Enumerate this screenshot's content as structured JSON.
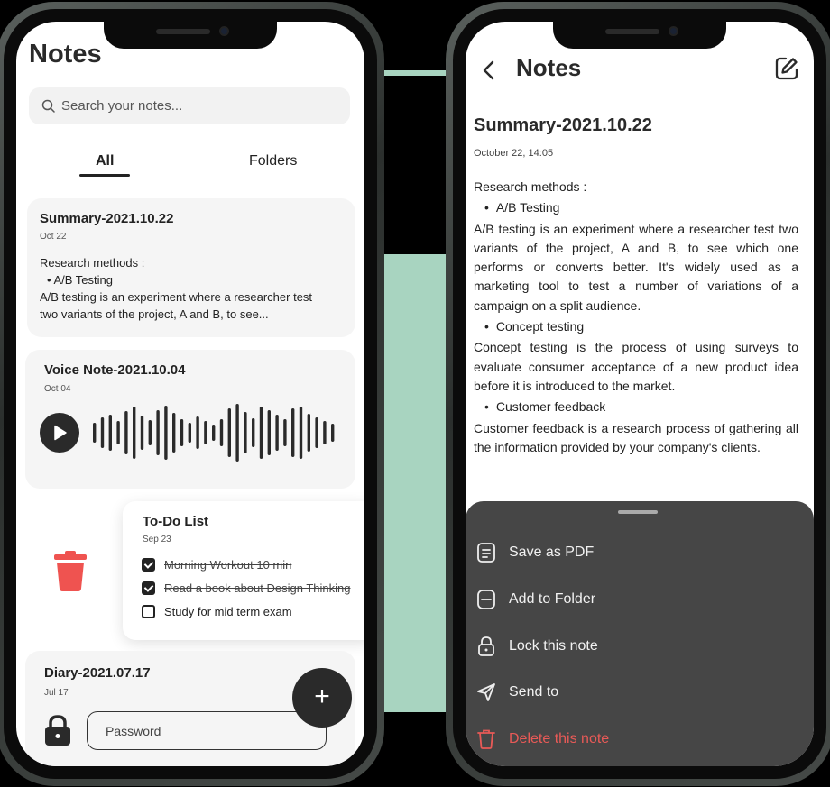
{
  "left": {
    "app_title": "Notes",
    "search_placeholder": "Search your notes...",
    "tabs": [
      {
        "label": "All",
        "active": true
      },
      {
        "label": "Folders",
        "active": false
      }
    ],
    "notes": [
      {
        "title": "Summary-2021.10.22",
        "date": "Oct 22",
        "lines": [
          "Research methods :",
          "A/B Testing",
          "A/B testing is an experiment where a researcher test",
          "two variants of the project, A and B, to see..."
        ]
      },
      {
        "title": "Voice Note-2021.10.04",
        "date": "Oct 04"
      }
    ],
    "todo": {
      "title": "To-Do List",
      "date": "Sep 23",
      "items": [
        {
          "label": "Morning Workout 10 min",
          "done": true
        },
        {
          "label": "Read a book about Design Thinking",
          "done": true
        },
        {
          "label": "Study for mid term exam",
          "done": false
        }
      ]
    },
    "diary": {
      "title": "Diary-2021.07.17",
      "date": "Jul 17",
      "password_placeholder": "Password"
    },
    "fab_label": "+"
  },
  "right": {
    "header_title": "Notes",
    "note": {
      "title": "Summary-2021.10.22",
      "datetime": "October 22, 14:05",
      "heading": "Research methods :",
      "bullet1": "A/B Testing",
      "para1": "A/B testing is an experiment where a researcher test two variants of the project, A and B, to see which one performs or converts better. It's widely used as a marketing tool to test a number of variations of a campaign on a split audience.",
      "bullet2": "Concept testing",
      "para2": "Concept testing is the process of using surveys to evaluate consumer acceptance of a new product idea before it is introduced to the market.",
      "bullet3": "Customer feedback",
      "para3": "Customer feedback is a research process of gathering all the information provided by your company's clients."
    },
    "sheet": {
      "items": [
        {
          "label": "Save as PDF",
          "icon": "pdf-file-icon"
        },
        {
          "label": "Add to Folder",
          "icon": "folder-icon"
        },
        {
          "label": "Lock this note",
          "icon": "lock-icon"
        },
        {
          "label": "Send to",
          "icon": "send-icon"
        },
        {
          "label": "Delete this note",
          "icon": "trash-icon"
        }
      ]
    }
  },
  "colors": {
    "dark": "#2a2a2a",
    "danger": "#e85a57",
    "sheet_bg": "#464646",
    "accent_green": "#a8d4c0"
  }
}
